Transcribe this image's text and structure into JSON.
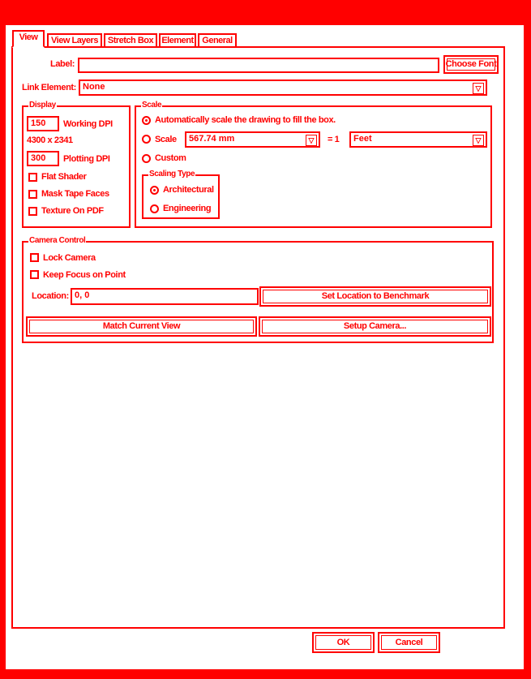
{
  "tabs": [
    {
      "label": "View",
      "active": true
    },
    {
      "label": "View Layers"
    },
    {
      "label": "Stretch Box"
    },
    {
      "label": "Element"
    },
    {
      "label": "General"
    }
  ],
  "label_row": {
    "label": "Label:",
    "value": "",
    "button": "Choose Font"
  },
  "link_row": {
    "label": "Link Element:",
    "value": "None"
  },
  "display": {
    "legend": "Display",
    "working_dpi": {
      "value": "150",
      "label": "Working DPI"
    },
    "resolution": "4300 x 2341",
    "plotting_dpi": {
      "value": "300",
      "label": "Plotting DPI"
    },
    "checkboxes": [
      "Flat Shader",
      "Mask Tape Faces",
      "Texture On PDF"
    ]
  },
  "scale": {
    "legend": "Scale",
    "auto_label": "Automatically scale the drawing to fill the box.",
    "scale_label": "Scale",
    "scale_value": "567.74 mm",
    "equals": "= 1",
    "unit_value": "Feet",
    "custom_label": "Custom",
    "scaling_type": {
      "legend": "Scaling Type",
      "options": [
        "Architectural",
        "Engineering"
      ]
    }
  },
  "camera": {
    "legend": "Camera Control",
    "lock_label": "Lock Camera",
    "focus_label": "Keep Focus on Point",
    "location_label": "Location:",
    "location_value": "0, 0",
    "set_location_button": "Set Location to Benchmark",
    "match_view_button": "Match Current View",
    "setup_camera_button": "Setup Camera..."
  },
  "footer": {
    "ok": "OK",
    "cancel": "Cancel"
  },
  "colors": {
    "accent": "#ff0000",
    "background": "#ffffff"
  },
  "icons": {
    "dropdown": "chevron-down-icon",
    "check": "checkbox-icon",
    "radio": "radio-icon"
  }
}
